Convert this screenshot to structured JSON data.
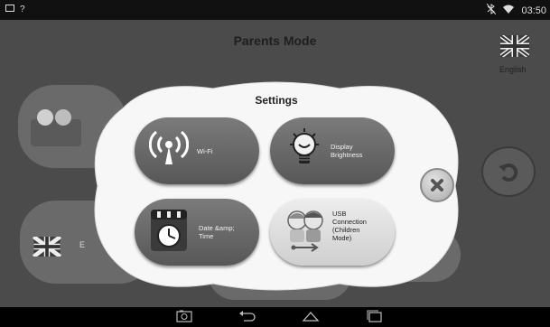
{
  "status_bar": {
    "time": "03:50"
  },
  "header": {
    "title": "Parents Mode",
    "language_label": "English",
    "flag_icon": "uk-flag-icon"
  },
  "background": {
    "partial_label": "E"
  },
  "dialog": {
    "title": "Settings",
    "tiles": [
      {
        "label": "Wi-Fi",
        "icon": "wifi-icon"
      },
      {
        "label": "Display Brightness",
        "icon": "lightbulb-icon"
      },
      {
        "label": "Date &amp; Time",
        "icon": "calendar-clock-icon"
      },
      {
        "label": "USB Connection (Children Mode)",
        "icon": "usb-icon"
      }
    ]
  },
  "nav": {
    "icons": [
      "camera-icon",
      "back-icon",
      "home-icon",
      "recents-icon"
    ]
  },
  "colors": {
    "app_background": "#4b4b4b",
    "dialog": "#f7f7f7",
    "dark_tile": "#666666"
  }
}
